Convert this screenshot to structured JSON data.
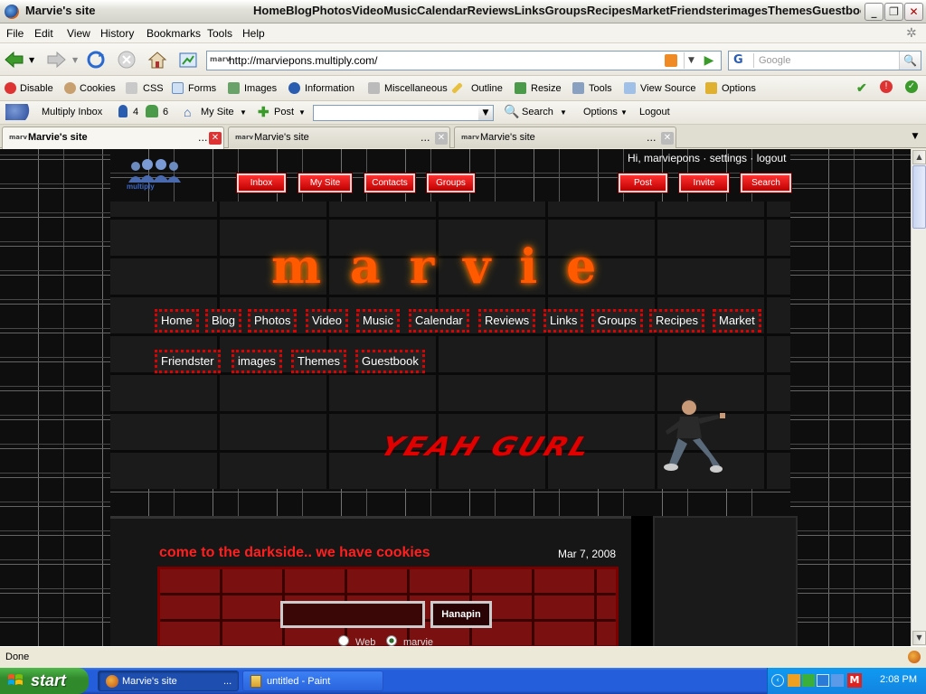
{
  "window": {
    "title": "Marvie's site",
    "nav_title": "HomeBlogPhotosVideoMusicCalendarReviewsLinksGroupsRecipesMarketFriendsterimagesThemesGuestbook…"
  },
  "menu": [
    "File",
    "Edit",
    "View",
    "History",
    "Bookmarks",
    "Tools",
    "Help"
  ],
  "address": {
    "url": "http://marviepons.multiply.com/",
    "favicon": "marv"
  },
  "search": {
    "engine": "G",
    "placeholder": "Google"
  },
  "webdev": [
    "Disable",
    "Cookies",
    "CSS",
    "Forms",
    "Images",
    "Information",
    "Miscellaneous",
    "Outline",
    "Resize",
    "Tools",
    "View Source",
    "Options"
  ],
  "multiply_bar": {
    "inbox": "Multiply Inbox",
    "contacts_count": "4",
    "groups_count": "6",
    "mysite": "My Site",
    "post": "Post",
    "search": "Search",
    "options": "Options",
    "logout": "Logout"
  },
  "tabs": [
    {
      "favicon": "marv",
      "title": "Marvie's site",
      "ellipsis": "..."
    },
    {
      "favicon": "marv",
      "title": "Marvie's site",
      "ellipsis": "..."
    },
    {
      "favicon": "marv",
      "title": "Marvie's site",
      "ellipsis": "..."
    }
  ],
  "page": {
    "logo_text": "multiply",
    "user_links": "Hi, marviepons · settings · logout",
    "top_buttons_left": [
      "Inbox",
      "My Site",
      "Contacts",
      "Groups"
    ],
    "top_buttons_right": [
      "Post",
      "Invite",
      "Search"
    ],
    "site_name": "marvie",
    "nav_row1": [
      "Home",
      "Blog",
      "Photos",
      "Video",
      "Music",
      "Calendar",
      "Reviews",
      "Links",
      "Groups",
      "Recipes",
      "Market"
    ],
    "nav_row2": [
      "Friendster",
      "images",
      "Themes",
      "Guestbook"
    ],
    "banner_text": "YEAH GURL",
    "post_title": "come to the darkside.. we have cookies",
    "post_date": "Mar 7, 2008",
    "search_button": "Hanapin",
    "radio_web": "Web",
    "radio_site": "marvie"
  },
  "status": {
    "text": "Done"
  },
  "taskbar": {
    "start": "start",
    "tasks": [
      {
        "title": "Marvie's site",
        "ellipsis": "..."
      },
      {
        "title": "untitled - Paint"
      }
    ],
    "clock": "2:08 PM"
  },
  "colors": {
    "accent_red": "#e00000",
    "flame": "#ff5a00",
    "xp_blue": "#245edb",
    "start_green": "#318a2c"
  }
}
